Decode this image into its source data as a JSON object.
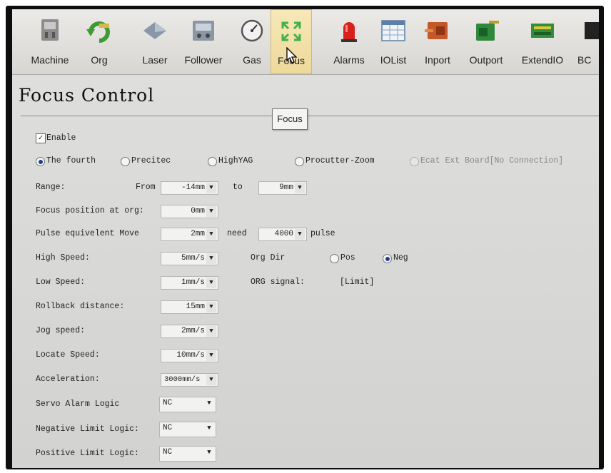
{
  "toolbar": {
    "items": [
      {
        "label": "Machine",
        "icon": "machine-icon"
      },
      {
        "label": "Org",
        "icon": "org-icon"
      },
      {
        "label": "Laser",
        "icon": "laser-icon"
      },
      {
        "label": "Follower",
        "icon": "follower-icon"
      },
      {
        "label": "Gas",
        "icon": "gas-gauge-icon"
      },
      {
        "label": "Focus",
        "icon": "focus-icon",
        "active": true
      },
      {
        "label": "Alarms",
        "icon": "alarm-icon"
      },
      {
        "label": "IOList",
        "icon": "iolist-icon"
      },
      {
        "label": "Inport",
        "icon": "inport-icon"
      },
      {
        "label": "Outport",
        "icon": "outport-icon"
      },
      {
        "label": "ExtendIO",
        "icon": "extendio-icon"
      },
      {
        "label": "BC",
        "icon": "bc-icon"
      }
    ]
  },
  "tooltip": "Focus",
  "page_title": "Focus Control",
  "enable_label": "Enable",
  "enable_checked": true,
  "focus_types": [
    {
      "label": "The fourth",
      "selected": true,
      "enabled": true
    },
    {
      "label": "Precitec",
      "selected": false,
      "enabled": true
    },
    {
      "label": "HighYAG",
      "selected": false,
      "enabled": true
    },
    {
      "label": "Procutter-Zoom",
      "selected": false,
      "enabled": true
    },
    {
      "label": "Ecat Ext Board[No Connection]",
      "selected": false,
      "enabled": false
    }
  ],
  "range": {
    "label": "Range:",
    "from_label": "From",
    "from_value": "-14mm",
    "to_label": "to",
    "to_value": "9mm"
  },
  "focus_position": {
    "label": "Focus position at org:",
    "value": "0mm"
  },
  "pulse": {
    "label": "Pulse equivelent Move",
    "value": "2mm",
    "need_label": "need",
    "need_value": "4000",
    "pulse_label": "pulse"
  },
  "high_speed": {
    "label": "High Speed:",
    "value": "5mm/s"
  },
  "org_dir": {
    "label": "Org Dir",
    "pos": "Pos",
    "neg": "Neg",
    "selected": "Neg"
  },
  "low_speed": {
    "label": "Low Speed:",
    "value": "1mm/s"
  },
  "org_signal": {
    "label": "ORG signal:",
    "value": "[Limit]"
  },
  "rollback": {
    "label": "Rollback distance:",
    "value": "15mm"
  },
  "jog_speed": {
    "label": "Jog speed:",
    "value": "2mm/s"
  },
  "locate_speed": {
    "label": "Locate Speed:",
    "value": "10mm/s"
  },
  "acceleration": {
    "label": "Acceleration:",
    "value": "3000mm/s"
  },
  "servo_alarm": {
    "label": "Servo Alarm Logic",
    "value": "NC"
  },
  "neg_limit": {
    "label": "Negative Limit Logic:",
    "value": "NC"
  },
  "pos_limit": {
    "label": "Positive Limit Logic:",
    "value": "NC"
  }
}
